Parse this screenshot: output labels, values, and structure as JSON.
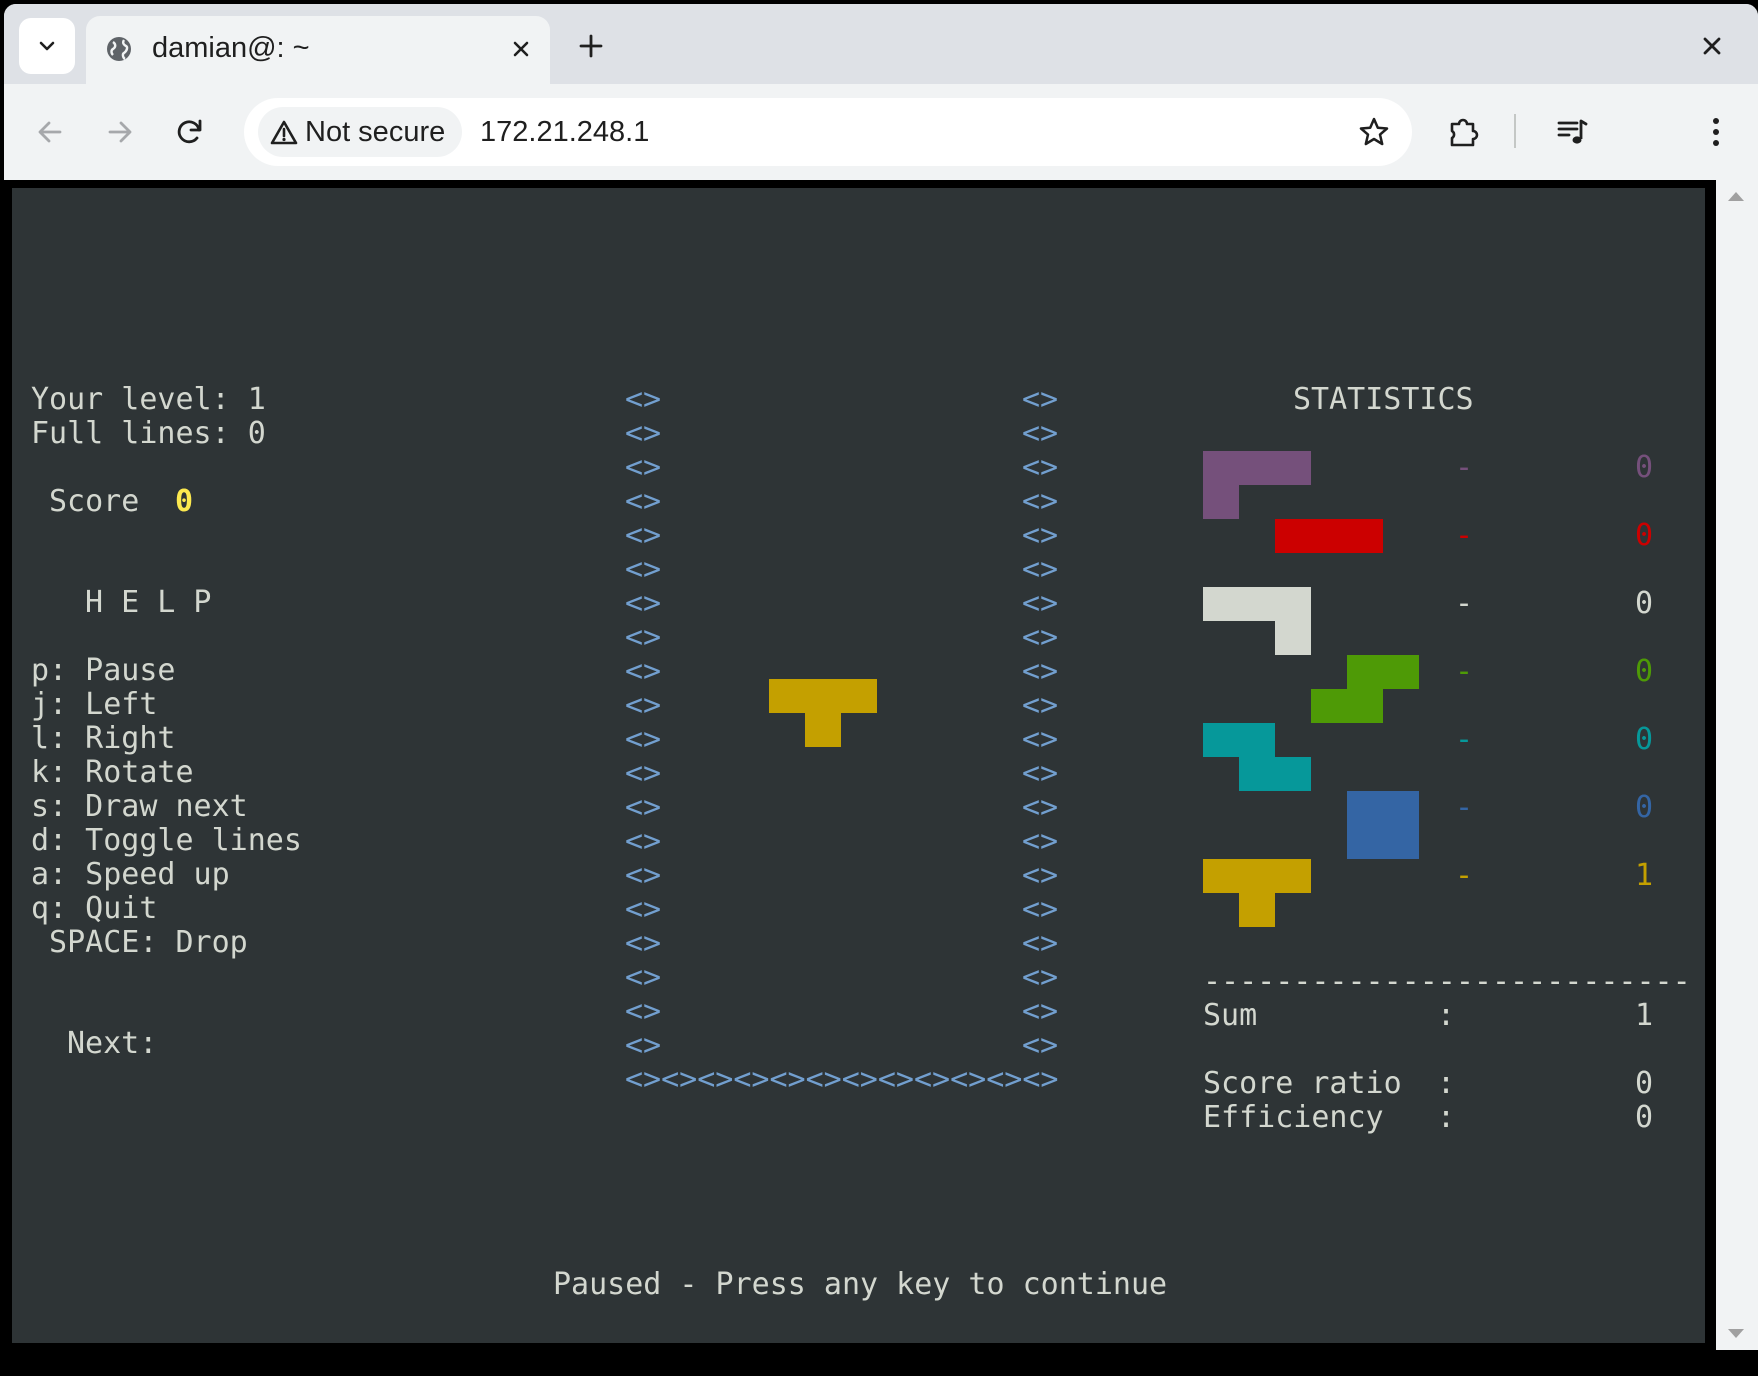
{
  "browser": {
    "tab_title": "damian@: ~",
    "security_label": "Not secure",
    "url": "172.21.248.1",
    "icons": {
      "tab_menu": "chevron-down-icon",
      "tab_favicon": "globe-icon",
      "tab_close": "close-icon",
      "new_tab": "plus-icon",
      "window_close": "close-icon",
      "back": "arrow-left-icon",
      "forward": "arrow-right-icon",
      "reload": "reload-icon",
      "security": "warning-icon",
      "bookmark": "star-icon",
      "extensions": "puzzle-icon",
      "media": "media-queue-icon",
      "menu": "kebab-menu-icon"
    }
  },
  "game": {
    "info": {
      "level_line": "Your level: 1",
      "lines_line": "Full lines: 0",
      "score_label": "Score",
      "score_value": "0",
      "score_color": "#fce94f"
    },
    "help": {
      "title": "H E L P",
      "keys": [
        "p: Pause",
        "j: Left",
        "l: Right",
        "k: Rotate",
        "s: Draw next",
        "d: Toggle lines",
        "a: Speed up",
        "q: Quit",
        " SPACE: Drop"
      ],
      "next_label": "Next:"
    },
    "well": {
      "wall_text": "<>",
      "floor_text": "<><><><><><><><><><><><>",
      "wall_color": "#729fcf",
      "rows": 20,
      "active_piece": {
        "type": "T",
        "color": "#c4a000"
      }
    },
    "statistics": {
      "title": "STATISTICS",
      "pieces": [
        {
          "shape": "J",
          "color": "#75507b",
          "dash": "-",
          "count": "0"
        },
        {
          "shape": "I",
          "color": "#cc0000",
          "dash": "-",
          "count": "0"
        },
        {
          "shape": "L",
          "color": "#d3d7cf",
          "dash": "-",
          "count": "0"
        },
        {
          "shape": "S",
          "color": "#4e9a06",
          "dash": "-",
          "count": "0"
        },
        {
          "shape": "Z",
          "color": "#06989a",
          "dash": "-",
          "count": "0"
        },
        {
          "shape": "O",
          "color": "#3465a4",
          "dash": "-",
          "count": "0"
        },
        {
          "shape": "T",
          "color": "#c4a000",
          "dash": "-",
          "count": "1"
        }
      ],
      "divider": "---------------------------",
      "sum_label": "Sum",
      "sum_colon": ":",
      "sum_value": "1",
      "score_ratio_label": "Score ratio",
      "score_ratio_colon": ":",
      "score_ratio_value": "0",
      "efficiency_label": "Efficiency",
      "efficiency_colon": ":",
      "efficiency_value": "0"
    },
    "status_message": "Paused - Press any key to continue"
  }
}
